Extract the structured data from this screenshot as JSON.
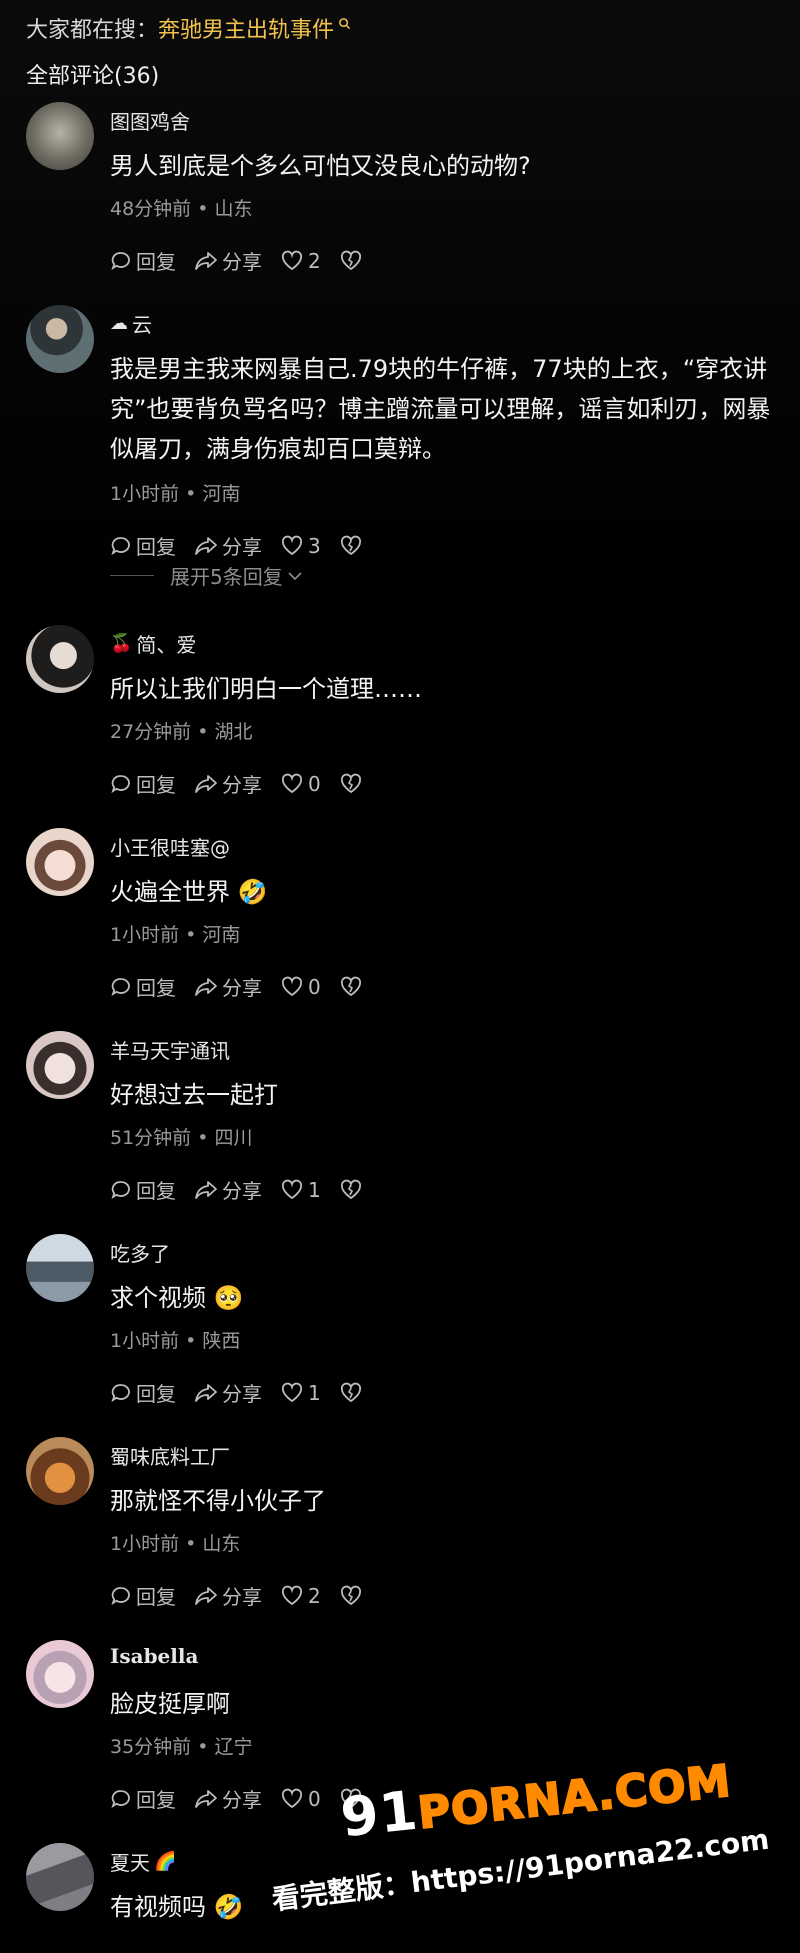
{
  "search_hint": {
    "prefix": "大家都在搜：",
    "term": "奔驰男主出轨事件"
  },
  "comment_count_title": "全部评论(36)",
  "actions": {
    "reply_label": "回复",
    "share_label": "分享"
  },
  "comments": [
    {
      "username": "图图鸡舍",
      "username_emoji": "",
      "text": "男人到底是个多么可怕又没良心的动物?",
      "meta": "48分钟前 • 山东",
      "likes": "2",
      "avatar_color": "#8d8a7c"
    },
    {
      "username": "云",
      "username_emoji": "☁",
      "text": "我是男主我来网暴自己.79块的牛仔裤，77块的上衣，“穿衣讲究”也要背负骂名吗？博主蹭流量可以理解，谣言如利刃，网暴似屠刀，满身伤痕却百口莫辩。",
      "meta": "1小时前 • 河南",
      "likes": "3",
      "expand_label": "展开5条回复",
      "avatar_color": "#4a5a5e"
    },
    {
      "username": "简、爱",
      "username_emoji": "🍒",
      "text": "所以让我们明白一个道理……",
      "meta": "27分钟前 • 湖北",
      "likes": "0",
      "avatar_color": "#c9c3bd"
    },
    {
      "username": "小王很哇塞@",
      "username_emoji": "",
      "text": "火遍全世界",
      "text_emoji": "🤣",
      "meta": "1小时前 • 河南",
      "likes": "0",
      "avatar_color": "#e7cfc4"
    },
    {
      "username": "羊马天宇通讯",
      "username_emoji": "",
      "text": "好想过去一起打",
      "meta": "51分钟前 • 四川",
      "likes": "1",
      "avatar_color": "#d9c7c6"
    },
    {
      "username": "吃多了",
      "username_emoji": "",
      "text": "求个视频",
      "text_emoji": "🥺",
      "meta": "1小时前 • 陕西",
      "likes": "1",
      "avatar_color": "#9fb3c4"
    },
    {
      "username": "蜀味底料工厂",
      "username_emoji": "",
      "text": "那就怪不得小伙子了",
      "meta": "1小时前 • 山东",
      "likes": "2",
      "avatar_color": "#a86f3e"
    },
    {
      "username": "Isabella",
      "username_emoji": "",
      "text": "脸皮挺厚啊",
      "meta": "35分钟前 • 辽宁",
      "likes": "0",
      "avatar_color": "#e9c9d6"
    },
    {
      "username": "夏天",
      "username_emoji_after": "🌈",
      "text": "有视频吗",
      "text_emoji": "🤣",
      "meta": "",
      "likes": "",
      "avatar_color": "#7e7e84"
    }
  ],
  "watermark": {
    "logo_num": "91",
    "logo_brand": "PORNA.COM",
    "url_line": "看完整版：https://91porna22.com"
  }
}
